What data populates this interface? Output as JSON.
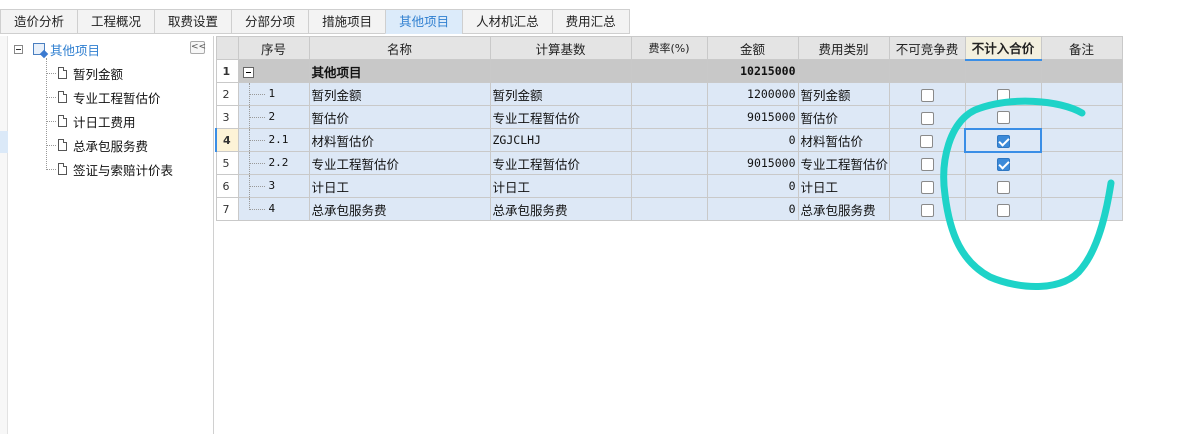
{
  "tabs": [
    {
      "label": "造价分析",
      "active": false
    },
    {
      "label": "工程概况",
      "active": false
    },
    {
      "label": "取费设置",
      "active": false
    },
    {
      "label": "分部分项",
      "active": false
    },
    {
      "label": "措施项目",
      "active": false
    },
    {
      "label": "其他项目",
      "active": true
    },
    {
      "label": "人材机汇总",
      "active": false
    },
    {
      "label": "费用汇总",
      "active": false
    }
  ],
  "tree": {
    "root": "其他项目",
    "collapse_glyph": "<<",
    "items": [
      "暂列金额",
      "专业工程暂估价",
      "计日工费用",
      "总承包服务费",
      "签证与索赔计价表"
    ]
  },
  "grid": {
    "headers": {
      "rownum": "",
      "seq": "序号",
      "name": "名称",
      "basis": "计算基数",
      "rate": "费率(%)",
      "amount": "金额",
      "category": "费用类别",
      "non_competitive": "不可竞争费",
      "exclude_total": "不计入合价",
      "remark": "备注"
    },
    "summary": {
      "rownum": "1",
      "name": "其他项目",
      "amount": "10215000"
    },
    "rows": [
      {
        "rownum": "2",
        "seq": "1",
        "name": "暂列金额",
        "basis": "暂列金额",
        "rate": "",
        "amount": "1200000",
        "category": "暂列金额",
        "non_competitive": false,
        "exclude_total": false,
        "remark": ""
      },
      {
        "rownum": "3",
        "seq": "2",
        "name": "暂估价",
        "basis": "专业工程暂估价",
        "rate": "",
        "amount": "9015000",
        "category": "暂估价",
        "non_competitive": false,
        "exclude_total": false,
        "remark": ""
      },
      {
        "rownum": "4",
        "seq": "2.1",
        "name": "材料暂估价",
        "basis": "ZGJCLHJ",
        "rate": "",
        "amount": "0",
        "category": "材料暂估价",
        "non_competitive": false,
        "exclude_total": true,
        "remark": ""
      },
      {
        "rownum": "5",
        "seq": "2.2",
        "name": "专业工程暂估价",
        "basis": "专业工程暂估价",
        "rate": "",
        "amount": "9015000",
        "category": "专业工程暂估价",
        "non_competitive": false,
        "exclude_total": true,
        "remark": ""
      },
      {
        "rownum": "6",
        "seq": "3",
        "name": "计日工",
        "basis": "计日工",
        "rate": "",
        "amount": "0",
        "category": "计日工",
        "non_competitive": false,
        "exclude_total": false,
        "remark": ""
      },
      {
        "rownum": "7",
        "seq": "4",
        "name": "总承包服务费",
        "basis": "总承包服务费",
        "rate": "",
        "amount": "0",
        "category": "总承包服务费",
        "non_competitive": false,
        "exclude_total": false,
        "remark": ""
      }
    ]
  },
  "colors": {
    "accent": "#2f7fd0",
    "annotation": "#1ed3c8"
  }
}
